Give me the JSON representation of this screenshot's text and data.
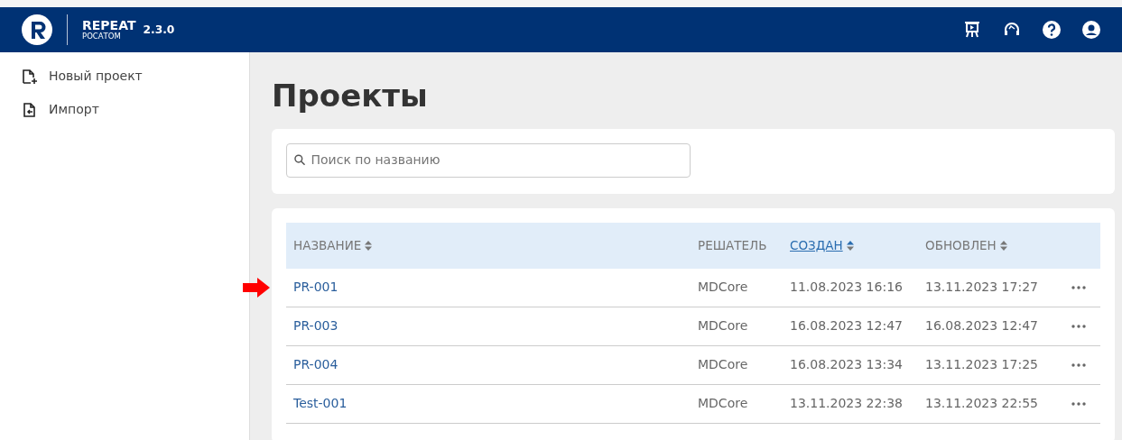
{
  "header": {
    "brand": "REPEAT",
    "sub": "РОСАТОМ",
    "version": "2.3.0"
  },
  "sidebar": {
    "items": [
      {
        "label": "Новый проект",
        "kind": "new"
      },
      {
        "label": "Импорт",
        "kind": "import"
      }
    ]
  },
  "page_title": "Проекты",
  "search": {
    "placeholder": "Поиск по названию"
  },
  "table": {
    "columns": [
      {
        "label": "НАЗВАНИЕ",
        "sortable": true,
        "selected": false
      },
      {
        "label": "РЕШАТЕЛЬ",
        "sortable": false,
        "selected": false
      },
      {
        "label": "СОЗДАН",
        "sortable": true,
        "selected": true
      },
      {
        "label": "ОБНОВЛЕН",
        "sortable": true,
        "selected": false
      }
    ],
    "rows": [
      {
        "name": "PR-001",
        "solver": "MDCore",
        "created": "11.08.2023 16:16",
        "updated": "13.11.2023 17:27",
        "marked": true
      },
      {
        "name": "PR-003",
        "solver": "MDCore",
        "created": "16.08.2023 12:47",
        "updated": "16.08.2023 12:47",
        "marked": false
      },
      {
        "name": "PR-004",
        "solver": "MDCore",
        "created": "16.08.2023 13:34",
        "updated": "13.11.2023 17:25",
        "marked": false
      },
      {
        "name": "Test-001",
        "solver": "MDCore",
        "created": "13.11.2023 22:38",
        "updated": "13.11.2023 22:55",
        "marked": false
      }
    ]
  }
}
